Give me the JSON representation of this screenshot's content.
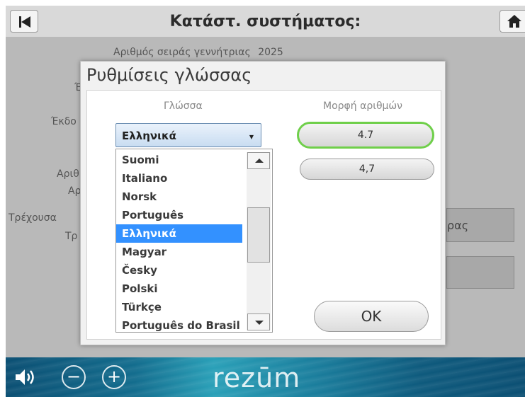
{
  "header": {
    "title": "Κατάστ. συστήματος:"
  },
  "background": {
    "generator_serial_label": "Αριθμός σειράς γεννήτριας",
    "generator_serial_value": "2025",
    "label_e": "Έ",
    "label_ekdo": "Έκδο",
    "label_arith1": "Αριθ",
    "label_ar": "Αρ",
    "label_trexousa": "Τρέχουσα",
    "label_tr": "Τρ",
    "button_partial": "ρας"
  },
  "modal": {
    "title": "Ρυθμίσεις γλώσσας",
    "language_label": "Γλώσσα",
    "number_format_label": "Μορφή αριθμών",
    "selected_language": "Ελληνικά",
    "languages": [
      "Suomi",
      "Italiano",
      "Norsk",
      "Português",
      "Ελληνικά",
      "Magyar",
      "Česky",
      "Polski",
      "Türkçe",
      "Português do Brasil"
    ],
    "selected_language_index": 4,
    "number_formats": [
      "4.7",
      "4,7"
    ],
    "selected_number_format_index": 0,
    "ok_label": "OK"
  },
  "footer": {
    "minus": "−",
    "plus": "+",
    "brand": "rezūm"
  },
  "colors": {
    "selection_blue": "#3391ff",
    "selected_outline_green": "#6fcf4a",
    "footer_teal": "#136d8e"
  }
}
